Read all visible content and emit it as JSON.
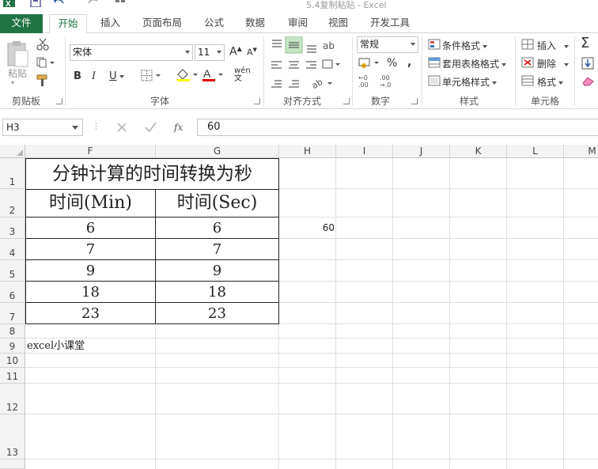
{
  "window": {
    "title": "5.4复制粘贴 - Excel"
  },
  "tabs": {
    "file": "文件",
    "items": [
      "开始",
      "插入",
      "页面布局",
      "公式",
      "数据",
      "审阅",
      "视图",
      "开发工具"
    ]
  },
  "ribbon": {
    "clipboard": {
      "label": "剪贴板",
      "paste": "粘贴"
    },
    "font": {
      "label": "字体",
      "name": "宋体",
      "size": "11",
      "bold": "B",
      "italic": "I",
      "underline": "U",
      "phonetic": "wén"
    },
    "alignment": {
      "label": "对齐方式"
    },
    "number": {
      "label": "数字",
      "format": "常规",
      "percent": "%",
      "comma": ","
    },
    "styles": {
      "label": "样式",
      "conditional": "条件格式",
      "table": "套用表格格式",
      "cell": "单元格样式"
    },
    "cells": {
      "label": "单元格",
      "insert": "插入",
      "delete": "删除",
      "format": "格式"
    }
  },
  "formula_bar": {
    "name_box": "H3",
    "formula": "60"
  },
  "sheet": {
    "columns": [
      "F",
      "G",
      "H",
      "I",
      "J",
      "K",
      "L",
      "M"
    ],
    "rows": [
      "1",
      "2",
      "3",
      "4",
      "5",
      "6",
      "7",
      "8",
      "9",
      "10",
      "11",
      "12",
      "13"
    ],
    "table_title": "分钟计算的时间转换为秒",
    "header_min": "时间(Min)",
    "header_sec": "时间(Sec)",
    "data": [
      {
        "min": "6",
        "sec": "6"
      },
      {
        "min": "7",
        "sec": "7"
      },
      {
        "min": "9",
        "sec": "9"
      },
      {
        "min": "18",
        "sec": "18"
      },
      {
        "min": "23",
        "sec": "23"
      }
    ],
    "h3_value": "60",
    "f9_text": "excel小课堂"
  }
}
